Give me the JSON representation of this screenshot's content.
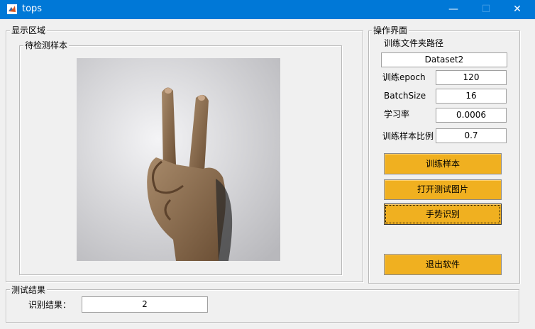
{
  "window": {
    "title": "tops",
    "minimize": "—",
    "maximize": "☐",
    "close": "✕"
  },
  "display": {
    "legend": "显示区域",
    "sample_legend": "待检测样本",
    "image_name": "hand-gesture-v-sign"
  },
  "ops": {
    "legend": "操作界面",
    "path_label": "训练文件夹路径",
    "path_value": "Dataset2",
    "epoch_label": "训练epoch",
    "epoch_value": "120",
    "batch_label": "BatchSize",
    "batch_value": "16",
    "lr_label": "学习率",
    "lr_value": "0.0006",
    "ratio_label": "训练样本比例",
    "ratio_value": "0.7",
    "train_button": "训练样本",
    "open_button": "打开测试图片",
    "recognize_button": "手势识别",
    "exit_button": "退出软件",
    "accent_color": "#f0b020"
  },
  "result": {
    "legend": "测试结果",
    "label": "识别结果：",
    "value": "2"
  }
}
